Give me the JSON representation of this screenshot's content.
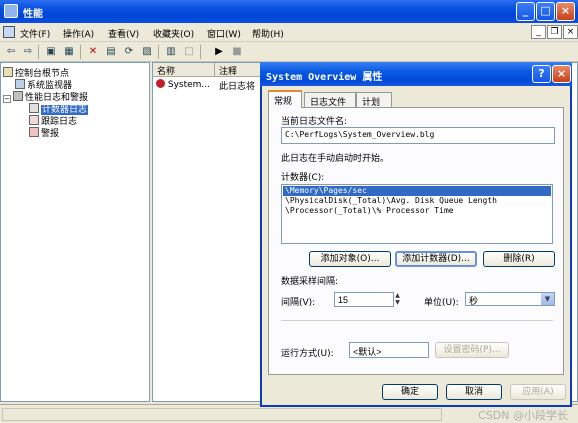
{
  "window": {
    "title": "性能"
  },
  "menubar": {
    "items": [
      "文件(F)",
      "操作(A)",
      "查看(V)",
      "收藏夹(O)",
      "窗口(W)",
      "帮助(H)"
    ],
    "mdi_controls": [
      "_",
      "❐",
      "×"
    ]
  },
  "tree": {
    "root": "控制台根节点",
    "items": [
      "系统监视器",
      "性能日志和警报",
      "计数器日志",
      "跟踪日志",
      "警报"
    ],
    "selected": "计数器日志"
  },
  "list": {
    "columns": [
      "名称",
      "注释"
    ],
    "rows": [
      {
        "name": "System...",
        "comment": "此日志将"
      }
    ]
  },
  "dialog": {
    "title": "System Overview 属性",
    "tabs": [
      "常规",
      "日志文件",
      "计划"
    ],
    "active_tab": "常规",
    "filename_label": "当前日志文件名:",
    "filename_value": "C:\\PerfLogs\\System_Overview.blg",
    "manual_note": "此日志在手动启动时开始。",
    "counters_label": "计数器(C):",
    "counters": [
      "\\Memory\\Pages/sec",
      "\\PhysicalDisk(_Total)\\Avg. Disk Queue Length",
      "\\Processor(_Total)\\% Processor Time"
    ],
    "selected_counter": 0,
    "add_objects_label": "添加对象(O)...",
    "add_counters_label": "添加计数器(D)...",
    "remove_label": "删除(R)",
    "sample_section_label": "数据采样间隔:",
    "interval_label": "间隔(V):",
    "interval_value": "15",
    "units_label": "单位(U):",
    "units_value": "秒",
    "run_as_label": "运行方式(U):",
    "run_as_value": "<默认>",
    "set_password_label": "设置密码(P)...",
    "ok_label": "确定",
    "cancel_label": "取消",
    "apply_label": "应用(A)"
  },
  "watermark": "CSDN @小段学长"
}
